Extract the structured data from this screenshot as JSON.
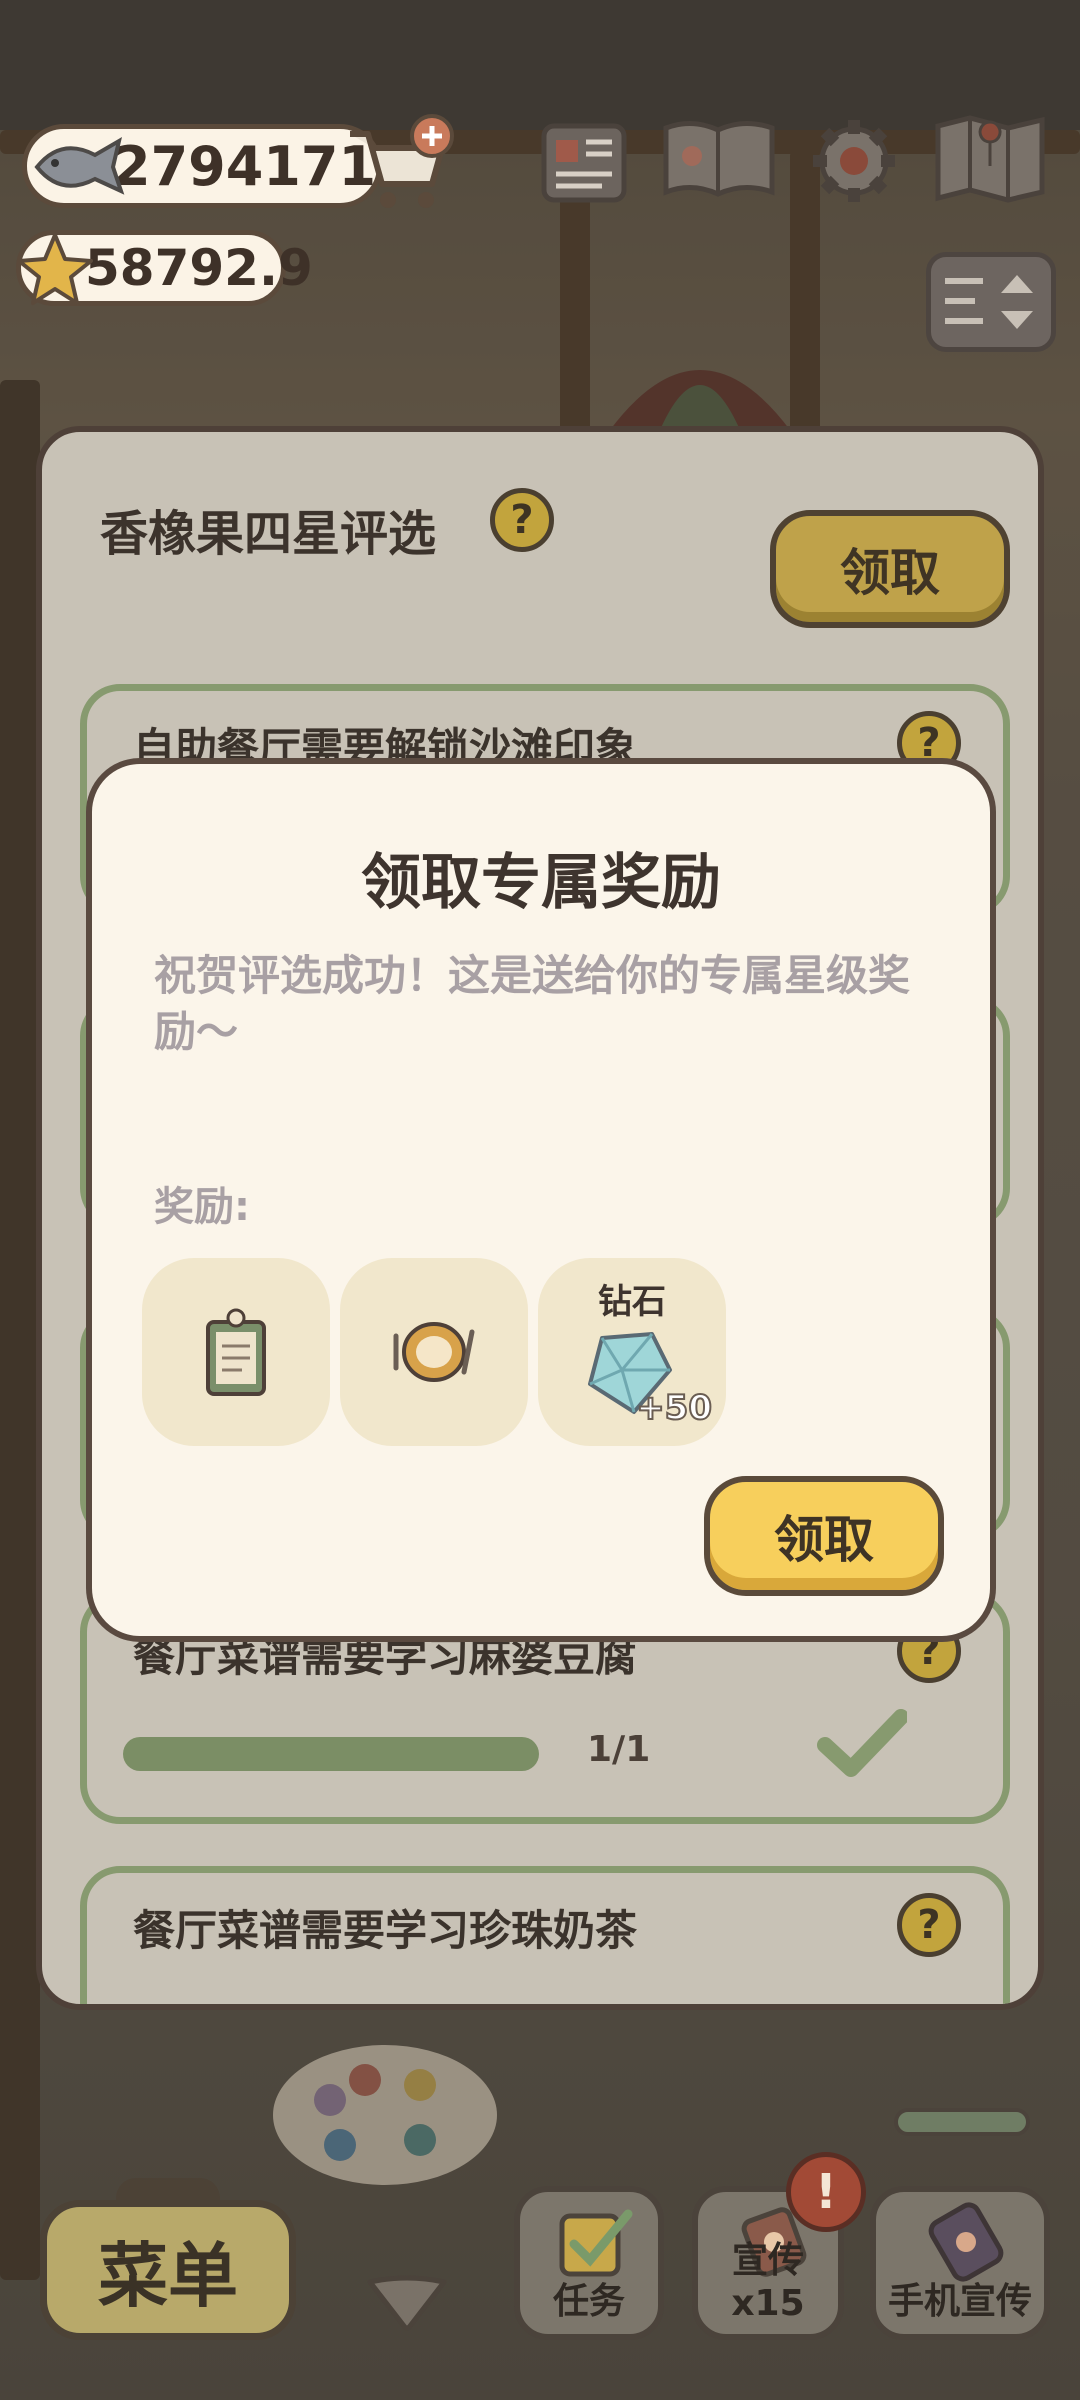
{
  "hud": {
    "fish_count": "2794171",
    "star_count": "58792.9"
  },
  "panel": {
    "title": "香橡果四星评选",
    "claim_label": "领取",
    "tasks": [
      {
        "text": "自助餐厅需要解锁沙滩印象"
      },
      {
        "text": "餐厅菜谱需要学习麻婆豆腐",
        "progress": "1/1",
        "progress_fraction": 1.0,
        "completed": true
      },
      {
        "text": "餐厅菜谱需要学习珍珠奶茶"
      }
    ]
  },
  "modal": {
    "title": "领取专属奖励",
    "description": "祝贺评选成功！这是送给你的专属星级奖励～",
    "reward_label": "奖励:",
    "rewards": [
      {
        "icon": "menu-board-icon"
      },
      {
        "icon": "dish-plate-icon"
      },
      {
        "name": "钻石",
        "icon": "diamond-icon",
        "quantity": "+50"
      }
    ],
    "claim_label": "领取"
  },
  "bottom_bar": {
    "menu_label": "菜单",
    "task_label": "任务",
    "promote_label": "宣传x15",
    "phone_promote_label": "手机宣传",
    "alert_symbol": "!"
  },
  "help_symbol": "?",
  "colors": {
    "panel_bg": "#c8c2b6",
    "modal_bg": "#fbf5ea",
    "claim_yellow": "#f7cf5c",
    "task_border_green": "#879a6f"
  }
}
